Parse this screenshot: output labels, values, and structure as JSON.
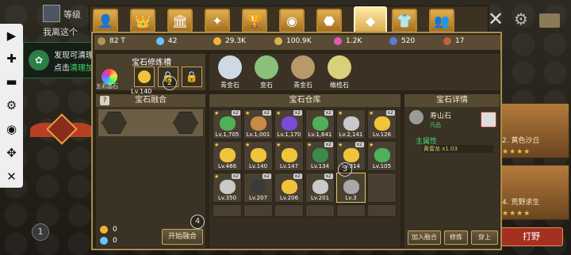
{
  "background": {
    "level_label": "等级",
    "subtitle": "我离这个",
    "cards": [
      {
        "caption": "2. 黄色沙丘",
        "stars": "★★★★"
      },
      {
        "caption": "4. 荒野求生",
        "stars": "★★★★"
      }
    ],
    "fight_label": "打野",
    "marker": "1"
  },
  "float_toolbar": {
    "items": [
      "play-icon",
      "plus-icon",
      "minus-icon",
      "gear-icon",
      "eye-off-icon",
      "move-icon",
      "close-icon"
    ]
  },
  "notice": {
    "line1": "发现可清理项",
    "line2_prefix": "点击",
    "line2_link": "清理加速"
  },
  "top_tabs": [
    {
      "name": "hero-tab",
      "glyph": "👤",
      "active": false
    },
    {
      "name": "crown-tab",
      "glyph": "👑",
      "active": false
    },
    {
      "name": "building-tab",
      "glyph": "🏛",
      "active": false
    },
    {
      "name": "star-tab",
      "glyph": "✦",
      "active": false
    },
    {
      "name": "trophy-tab",
      "glyph": "🏆",
      "active": false
    },
    {
      "name": "eye-tab",
      "glyph": "◉",
      "active": false
    },
    {
      "name": "gem-tab",
      "glyph": "⬣",
      "active": false
    },
    {
      "name": "gemstone-tab",
      "glyph": "◆",
      "active": true
    },
    {
      "name": "shirt-tab",
      "glyph": "👕",
      "active": false
    },
    {
      "name": "friends-tab",
      "glyph": "👥",
      "active": false
    }
  ],
  "resources": [
    {
      "name": "power",
      "value": "82 T",
      "color": "#b39358"
    },
    {
      "name": "diamond",
      "value": "42",
      "color": "#66c6ff"
    },
    {
      "name": "gold",
      "value": "29.3K",
      "color": "#f2b13a"
    },
    {
      "name": "crystal",
      "value": "100.9K",
      "color": "#d8b54a"
    },
    {
      "name": "flower",
      "value": "1.2K",
      "color": "#e45ab3"
    },
    {
      "name": "stone",
      "value": "520",
      "color": "#5a7bd8"
    },
    {
      "name": "chest",
      "value": "17",
      "color": "#c2613a"
    }
  ],
  "slots": {
    "title": "宝石修炼槽",
    "level": "Lv.140",
    "caption": "五彩晶石",
    "marker": "2"
  },
  "samples": [
    {
      "name": "青金石",
      "color": "#cfd9e6"
    },
    {
      "name": "变石",
      "color": "#8bbf7c"
    },
    {
      "name": "青金石",
      "color": "#b8996a"
    },
    {
      "name": "橄榄石",
      "color": "#d9d07a"
    }
  ],
  "fusion": {
    "title": "宝石融合",
    "help": "?",
    "gold_count": "0",
    "diamond_count": "0",
    "fuse_label": "开始融合",
    "marker": "4"
  },
  "warehouse": {
    "title": "宝石仓库",
    "marker": "3",
    "items": [
      {
        "lv": "Lv.1,705",
        "color": "#4fb05a",
        "star": true,
        "badge": "x2"
      },
      {
        "lv": "Lv.1,001",
        "color": "#c98a46",
        "star": true,
        "badge": "x2"
      },
      {
        "lv": "Lv.1,170",
        "color": "#7a4ad8",
        "star": true,
        "badge": "x2"
      },
      {
        "lv": "Lv.1,641",
        "color": "#4fb05a",
        "star": false,
        "badge": "x2"
      },
      {
        "lv": "Lv.2,141",
        "color": "#c9c9c9",
        "star": true,
        "badge": ""
      },
      {
        "lv": "Lv.126",
        "color": "#f0c43a",
        "star": true,
        "badge": "x2"
      },
      {
        "lv": "Lv.466",
        "color": "#f0c43a",
        "star": true,
        "badge": ""
      },
      {
        "lv": "Lv.140",
        "color": "#f0c43a",
        "star": true,
        "badge": ""
      },
      {
        "lv": "Lv.147",
        "color": "#f0c43a",
        "star": true,
        "badge": ""
      },
      {
        "lv": "Lv.134",
        "color": "#3c8a4a",
        "star": true,
        "badge": "x2"
      },
      {
        "lv": "Lv.314",
        "color": "#f0c43a",
        "star": true,
        "badge": "x2"
      },
      {
        "lv": "Lv.105",
        "color": "#4fb05a",
        "star": true,
        "badge": ""
      },
      {
        "lv": "Lv.350",
        "color": "#c9c9c9",
        "star": true,
        "badge": "x2"
      },
      {
        "lv": "Lv.207",
        "color": "#3a3a3a",
        "star": false,
        "badge": "x2"
      },
      {
        "lv": "Lv.206",
        "color": "#f0c43a",
        "star": false,
        "badge": "x2"
      },
      {
        "lv": "Lv.201",
        "color": "#c9c9c9",
        "star": false,
        "badge": "x2"
      },
      {
        "lv": "Lv.3",
        "color": "#a8a8a8",
        "star": false,
        "badge": "",
        "selected": true
      },
      {
        "lv": "",
        "color": "",
        "star": false,
        "badge": ""
      }
    ]
  },
  "detail": {
    "title": "宝石详情",
    "name": "寿山石",
    "grade": "凡品",
    "attr_title": "主属性",
    "attr_value": "黄雷龙 x1.03",
    "buttons": [
      "加入融合",
      "修炼",
      "穿上"
    ]
  }
}
